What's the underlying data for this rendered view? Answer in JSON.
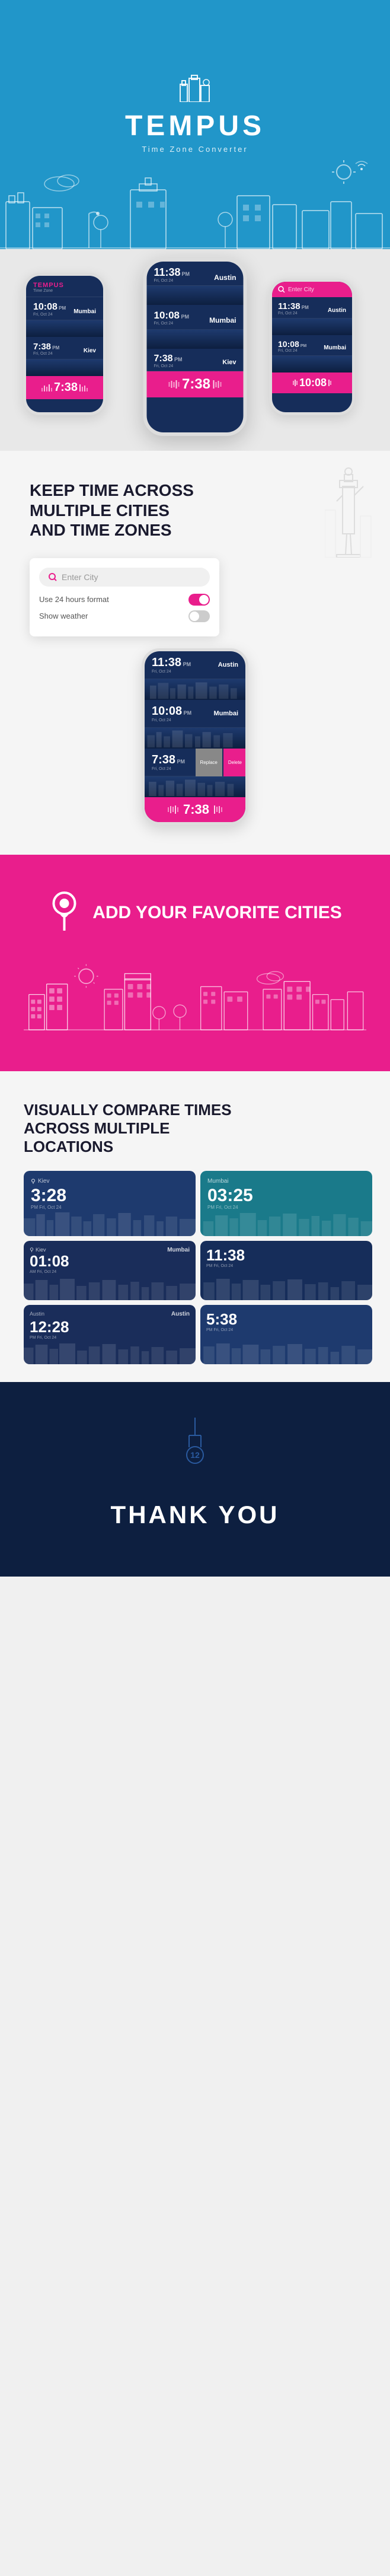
{
  "hero": {
    "title": "TEMPUS",
    "subtitle": "Time Zone Converter",
    "bg_color": "#2196c9"
  },
  "section2": {
    "label": "phone-mockups-section"
  },
  "section3": {
    "title": "KEEP TIME ACROSS MULTIPLE CITIES AND TIME ZONES",
    "ui": {
      "placeholder": "Enter City",
      "option1_label": "Use 24 hours format",
      "option1_on": true,
      "option2_label": "Show weather",
      "option2_on": false
    },
    "phone": {
      "rows": [
        {
          "time": "11:38",
          "ampm": "PM",
          "date": "Fri, Oct 24",
          "city": "Austin"
        },
        {
          "time": "10:08",
          "ampm": "PM",
          "date": "Fri, Oct 24",
          "city": "Mumbai"
        },
        {
          "time": "7:38",
          "ampm": "PM",
          "date": "Fri, Oct 24",
          "city": "Kiev"
        }
      ],
      "timeline_time": "7:38",
      "replace_btn": "Replace",
      "delete_btn": "Delete"
    }
  },
  "section4": {
    "title": "ADD YOUR FAVORITE CITIES",
    "bg_color": "#e91e8c"
  },
  "section5": {
    "title": "VISUALLY COMPARE TIMES ACROSS MULTIPLE LOCATIONS",
    "cards": [
      {
        "time": "3:28",
        "ampm": "PM",
        "date": "Fri, Oct 24",
        "city": "Kiev",
        "bg": "#1e3a6e"
      },
      {
        "time": "03:25",
        "ampm": "PM",
        "date": "Fri, Oct 24",
        "city": "Mumbai",
        "bg": "#1a7a8a"
      },
      {
        "time": "01:08",
        "ampm": "AM",
        "date": "Fri, Oct 24",
        "city": "Mumbai",
        "bg": "#1a2d5a",
        "city2": "Kiev"
      },
      {
        "time": "11:38",
        "ampm": "PM",
        "date": "Fri, Oct 24",
        "city": "",
        "bg": "#162d5a"
      },
      {
        "time": "12:28",
        "ampm": "PM",
        "date": "Fri, Oct 24",
        "city": "Austin",
        "bg": "#1a2d5a",
        "city2": "Austin"
      },
      {
        "time": "5:38",
        "ampm": "PM",
        "date": "Fri, Oct 24",
        "city": "",
        "bg": "#1e3a6e"
      }
    ]
  },
  "section6": {
    "badge_number": "12",
    "thank_you": "THANK YOU",
    "bg_color": "#0d1f40"
  },
  "phones_section2": {
    "phone1": {
      "rows": [
        {
          "time": "10:08",
          "city": "Mumbai"
        },
        {
          "time": "7:38",
          "city": "Kiev"
        }
      ],
      "pink_time": "7:38"
    },
    "phone2": {
      "rows": [
        {
          "time": "11:38",
          "city": "Austin"
        },
        {
          "time": "10:08",
          "city": "Mumbai"
        },
        {
          "time": "7:38",
          "city": "Kiev"
        }
      ],
      "pink_time": "7:38"
    },
    "phone3": {
      "rows": [
        {
          "time": "11:38",
          "city": "Austin"
        }
      ],
      "search_label": "Enter City"
    }
  }
}
